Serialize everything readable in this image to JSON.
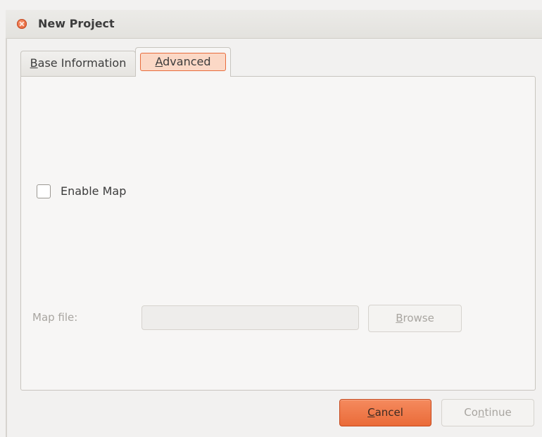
{
  "window": {
    "title": "New Project"
  },
  "tabs": [
    {
      "label_mnemonic": "B",
      "label_rest": "ase Information",
      "active": false
    },
    {
      "label_mnemonic": "A",
      "label_rest": "dvanced",
      "active": true
    }
  ],
  "advanced": {
    "enable_map": {
      "label": "Enable Map",
      "checked": false
    },
    "map_file": {
      "label": "Map file:",
      "value": "",
      "enabled": false
    },
    "browse_button": {
      "label_mnemonic": "B",
      "label_rest": "rowse",
      "enabled": false
    }
  },
  "footer": {
    "cancel": {
      "label_mnemonic": "C",
      "label_rest": "ancel"
    },
    "continue": {
      "label_pre": "Co",
      "label_mnemonic": "n",
      "label_rest": "tinue",
      "enabled": false
    }
  },
  "colors": {
    "accent": "#ea6b39",
    "window_bg": "#f2f1f0",
    "disabled_text": "#a8a5a0"
  }
}
